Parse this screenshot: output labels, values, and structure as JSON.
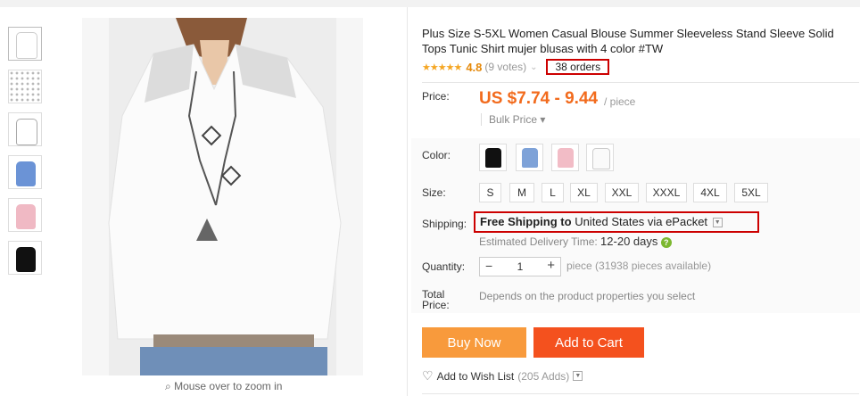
{
  "product": {
    "title": "Plus Size S-5XL Women Casual Blouse Summer Sleeveless Stand Sleeve Solid Tops Tunic Shirt mujer blusas with 4 color #TW",
    "rating": {
      "stars": "★★★★★",
      "value": "4.8",
      "votes": "(9 votes)",
      "orders": "38 orders"
    }
  },
  "price": {
    "label": "Price:",
    "value": "US $7.74 - 9.44",
    "unit": "/ piece",
    "bulk": "Bulk Price"
  },
  "options": {
    "color_label": "Color:",
    "colors": [
      "black",
      "blue",
      "pink",
      "white"
    ],
    "size_label": "Size:",
    "sizes": [
      "S",
      "M",
      "L",
      "XL",
      "XXL",
      "XXXL",
      "4XL",
      "5XL"
    ]
  },
  "shipping": {
    "label": "Shipping:",
    "free_text": "Free Shipping to",
    "destination": "United States via ePacket",
    "estimate_label": "Estimated Delivery Time:",
    "estimate_value": "12-20 days"
  },
  "quantity": {
    "label": "Quantity:",
    "value": "1",
    "available": "piece (31938 pieces available)"
  },
  "total": {
    "label": "Total Price:",
    "value": "Depends on the product properties you select"
  },
  "actions": {
    "buy_now": "Buy Now",
    "add_to_cart": "Add to Cart",
    "wishlist": "Add to Wish List",
    "wishlist_adds": "(205 Adds)"
  },
  "gallery": {
    "zoom_hint": "Mouse over to zoom in"
  },
  "colors": {
    "accent": "#f26b1d",
    "buy_now_bg": "#f89a3c",
    "cart_bg": "#f4511e",
    "highlight_border": "#cc0000",
    "star": "#f5a623"
  }
}
